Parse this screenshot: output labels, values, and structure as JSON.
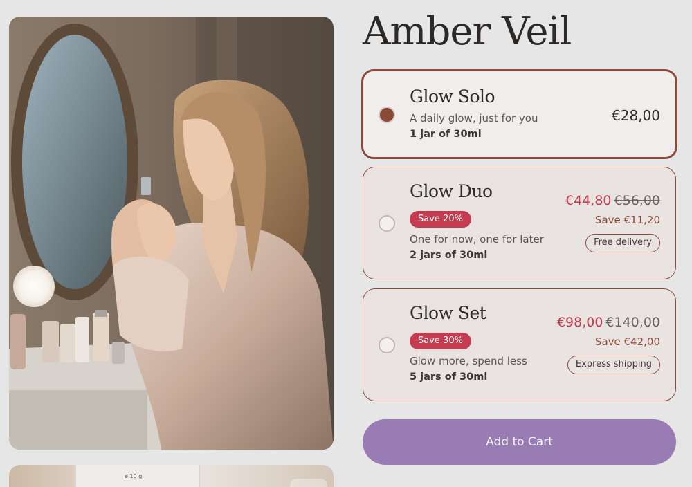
{
  "product": {
    "title": "Amber Veil"
  },
  "gallery": {
    "main_image_alt": "Woman applying cream at vanity mirror",
    "thumb_label": "e 10 g"
  },
  "offers": [
    {
      "name": "Glow Solo",
      "selected": true,
      "tagline": "A daily glow, just for you",
      "quantity": "1 jar of 30ml",
      "price": "€28,00"
    },
    {
      "name": "Glow Duo",
      "selected": false,
      "badge": "Save 20%",
      "tagline": "One for now, one for later",
      "quantity": "2 jars of 30ml",
      "sale_price": "€44,80",
      "original_price": "€56,00",
      "savings": "Save €11,20",
      "perk": "Free delivery"
    },
    {
      "name": "Glow Set",
      "selected": false,
      "badge": "Save 30%",
      "tagline": "Glow more, spend less",
      "quantity": "5 jars of 30ml",
      "sale_price": "€98,00",
      "original_price": "€140,00",
      "savings": "Save €42,00",
      "perk": "Express shipping"
    }
  ],
  "cart": {
    "button_label": "Add to Cart"
  },
  "colors": {
    "accent_brown": "#8a4a38",
    "sale_red": "#c53b4f",
    "cart_purple": "#9a7cb4",
    "background": "#e7e6e6"
  }
}
